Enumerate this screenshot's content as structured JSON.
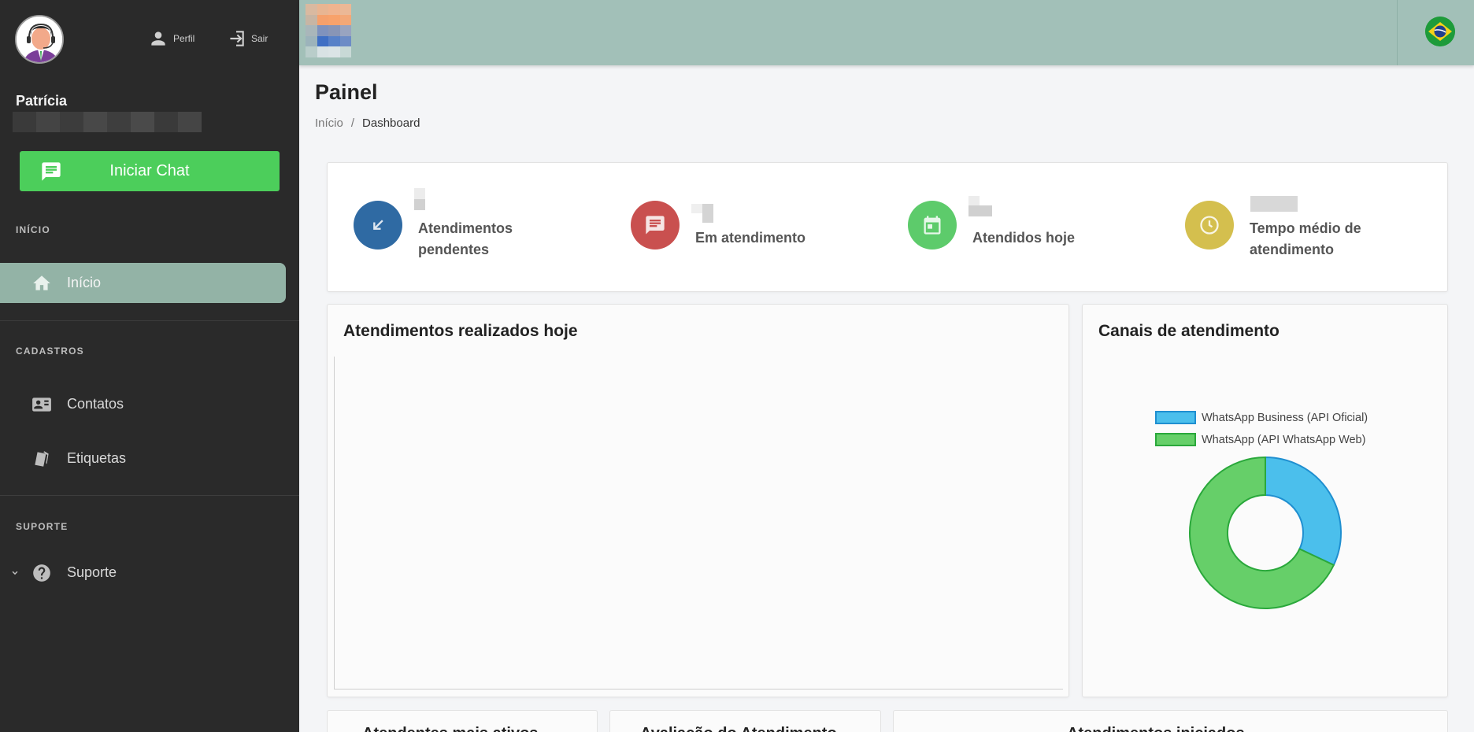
{
  "sidebar": {
    "user": {
      "name": "Patrícia",
      "avatar_icon": "headset-agent-avatar"
    },
    "links": {
      "profile": "Perfil",
      "logout": "Sair"
    },
    "chat_button": "Iniciar Chat",
    "sections": [
      {
        "title": "INÍCIO",
        "items": [
          {
            "label": "Início",
            "icon": "home-icon",
            "active": true
          }
        ]
      },
      {
        "title": "CADASTROS",
        "items": [
          {
            "label": "Contatos",
            "icon": "contact-card-icon"
          },
          {
            "label": "Etiquetas",
            "icon": "tags-icon"
          }
        ]
      },
      {
        "title": "SUPORTE",
        "items": [
          {
            "label": "Suporte",
            "icon": "help-icon",
            "expandable": true
          }
        ]
      }
    ]
  },
  "header": {
    "language_flag": "brazil-flag-icon"
  },
  "page": {
    "title": "Painel",
    "breadcrumb": [
      "Início",
      "/",
      "Dashboard"
    ]
  },
  "stats": [
    {
      "label": "Atendimentos pendentes",
      "icon": "arrow-down-left-icon",
      "color": "#2f6aa3"
    },
    {
      "label": "Em atendimento",
      "icon": "chat-icon",
      "color": "#c9504f"
    },
    {
      "label": "Atendidos hoje",
      "icon": "calendar-icon",
      "color": "#5dcb6b"
    },
    {
      "label": "Tempo médio de atendimento",
      "icon": "clock-icon",
      "color": "#d4bf4e"
    }
  ],
  "cards": {
    "today": {
      "title": "Atendimentos realizados hoje"
    },
    "channels": {
      "title": "Canais de atendimento"
    },
    "bottom": [
      "Atendentes mais ativos",
      "Avaliação do Atendimento",
      "Atendimentos iniciados"
    ]
  },
  "chart_data": {
    "type": "pie",
    "donut": true,
    "title": "Canais de atendimento",
    "legend_position": "top",
    "series": [
      {
        "name": "WhatsApp Business (API Oficial)",
        "value": 32,
        "color": "#4bbfec",
        "border": "#1f8fd0"
      },
      {
        "name": "WhatsApp (API WhatsApp Web)",
        "value": 68,
        "color": "#66cf69",
        "border": "#2aa83b"
      }
    ]
  }
}
